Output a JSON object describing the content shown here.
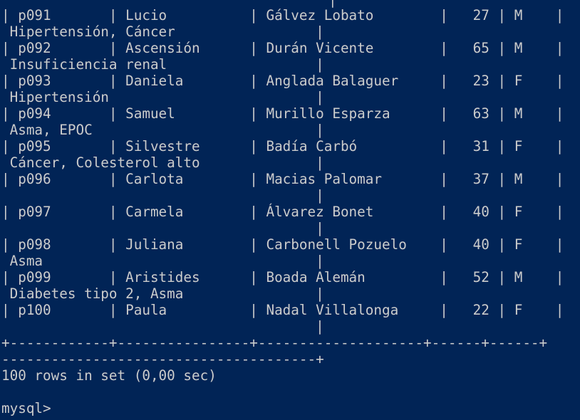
{
  "window": {
    "app": "MySQL command-line client",
    "background_color": "#012456",
    "text_color": "#cccccc"
  },
  "output_lines": [
    "|",
    "| p091       | Lucio          | Gálvez Lobato        |   27 | M    |",
    " Hipertensión, Cáncer                 |",
    "| p092       | Ascensión      | Durán Vicente        |   65 | M    |",
    " Insuficiencia renal                  |",
    "| p093       | Daniela        | Anglada Balaguer     |   23 | F    |",
    " Hipertensión                         |",
    "| p094       | Samuel         | Murillo Esparza      |   63 | M    |",
    " Asma, EPOC                           |",
    "| p095       | Silvestre      | Badía Carbó          |   31 | F    |",
    " Cáncer, Colesterol alto              |",
    "| p096       | Carlota        | Macias Palomar       |   37 | M    |",
    "                                      |",
    "| p097       | Carmela        | Álvarez Bonet        |   40 | F    |",
    "                                      |",
    "| p098       | Juliana        | Carbonell Pozuelo    |   40 | F    |",
    " Asma                                 |",
    "| p099       | Aristides      | Boada Alemán         |   52 | M    |",
    " Diabetes tipo 2, Asma                |",
    "| p100       | Paula          | Nadal Villalonga     |   22 | F    |",
    "                                      |",
    "+------------+----------------+--------------------+------+------+",
    "--------------------------------------+",
    "100 rows in set (0,00 sec)",
    "",
    "mysql>"
  ]
}
